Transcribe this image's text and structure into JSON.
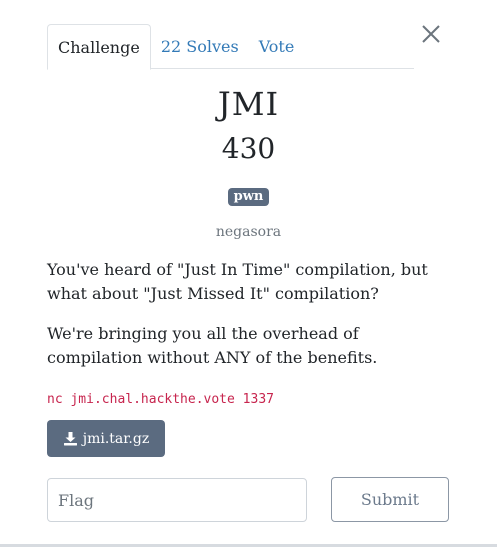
{
  "tabs": [
    {
      "label": "Challenge",
      "active": true
    },
    {
      "label": "22 Solves",
      "active": false
    },
    {
      "label": "Vote",
      "active": false
    }
  ],
  "close_icon": "close-icon",
  "challenge": {
    "name": "JMI",
    "value": "430",
    "category": "pwn",
    "author": "negasora",
    "description": [
      "You've heard of \"Just In Time\" compilation, but what about \"Just Missed It\" compilation?",
      "We're bringing you all the overhead of compilation without ANY of the benefits."
    ],
    "connection": "nc jmi.chal.hackthe.vote 1337",
    "file": {
      "name": "jmi.tar.gz",
      "icon": "download-icon"
    }
  },
  "form": {
    "flag_placeholder": "Flag",
    "flag_value": "",
    "submit_label": "Submit"
  },
  "colors": {
    "link": "#337ab7",
    "badge": "#5b6b80",
    "code": "#c7254e",
    "muted": "#6c757d"
  }
}
